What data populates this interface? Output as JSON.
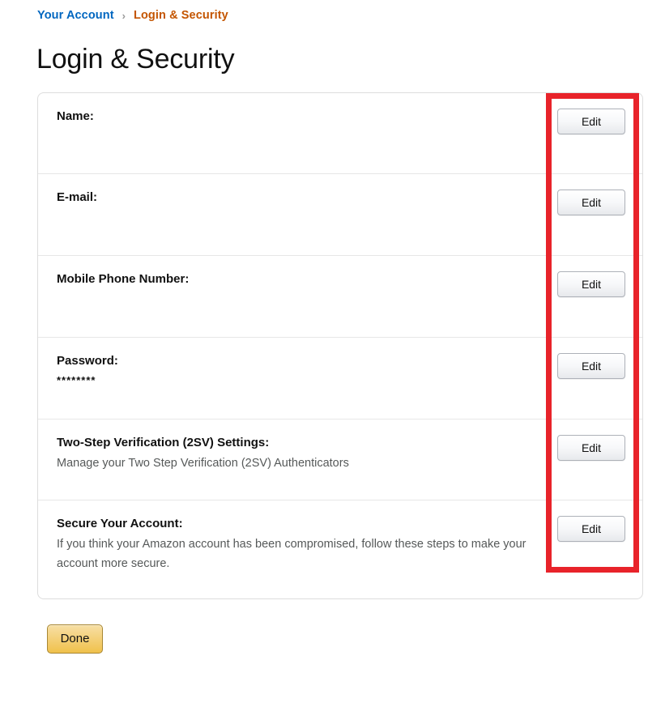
{
  "breadcrumb": {
    "parent_label": "Your Account",
    "separator": "›",
    "current_label": "Login & Security",
    "parent_color": "#0066c0",
    "current_color": "#c45500"
  },
  "page": {
    "title": "Login & Security"
  },
  "panel": {
    "rows": [
      {
        "label": "Name:",
        "value": "",
        "description": "",
        "edit_label": "Edit"
      },
      {
        "label": "E-mail:",
        "value": "",
        "description": "",
        "edit_label": "Edit"
      },
      {
        "label": "Mobile Phone Number:",
        "value": "",
        "description": "",
        "edit_label": "Edit"
      },
      {
        "label": "Password:",
        "value": "********",
        "description": "",
        "edit_label": "Edit"
      },
      {
        "label": "Two-Step Verification (2SV) Settings:",
        "value": "",
        "description": "Manage your Two Step Verification (2SV) Authenticators",
        "edit_label": "Edit"
      },
      {
        "label": "Secure Your Account:",
        "value": "",
        "description": "If you think your Amazon account has been compromised, follow these steps to make your account more secure.",
        "edit_label": "Edit"
      }
    ]
  },
  "footer": {
    "done_label": "Done"
  },
  "annotation": {
    "highlight_color": "#e8232a",
    "target": "edit-buttons-column"
  }
}
